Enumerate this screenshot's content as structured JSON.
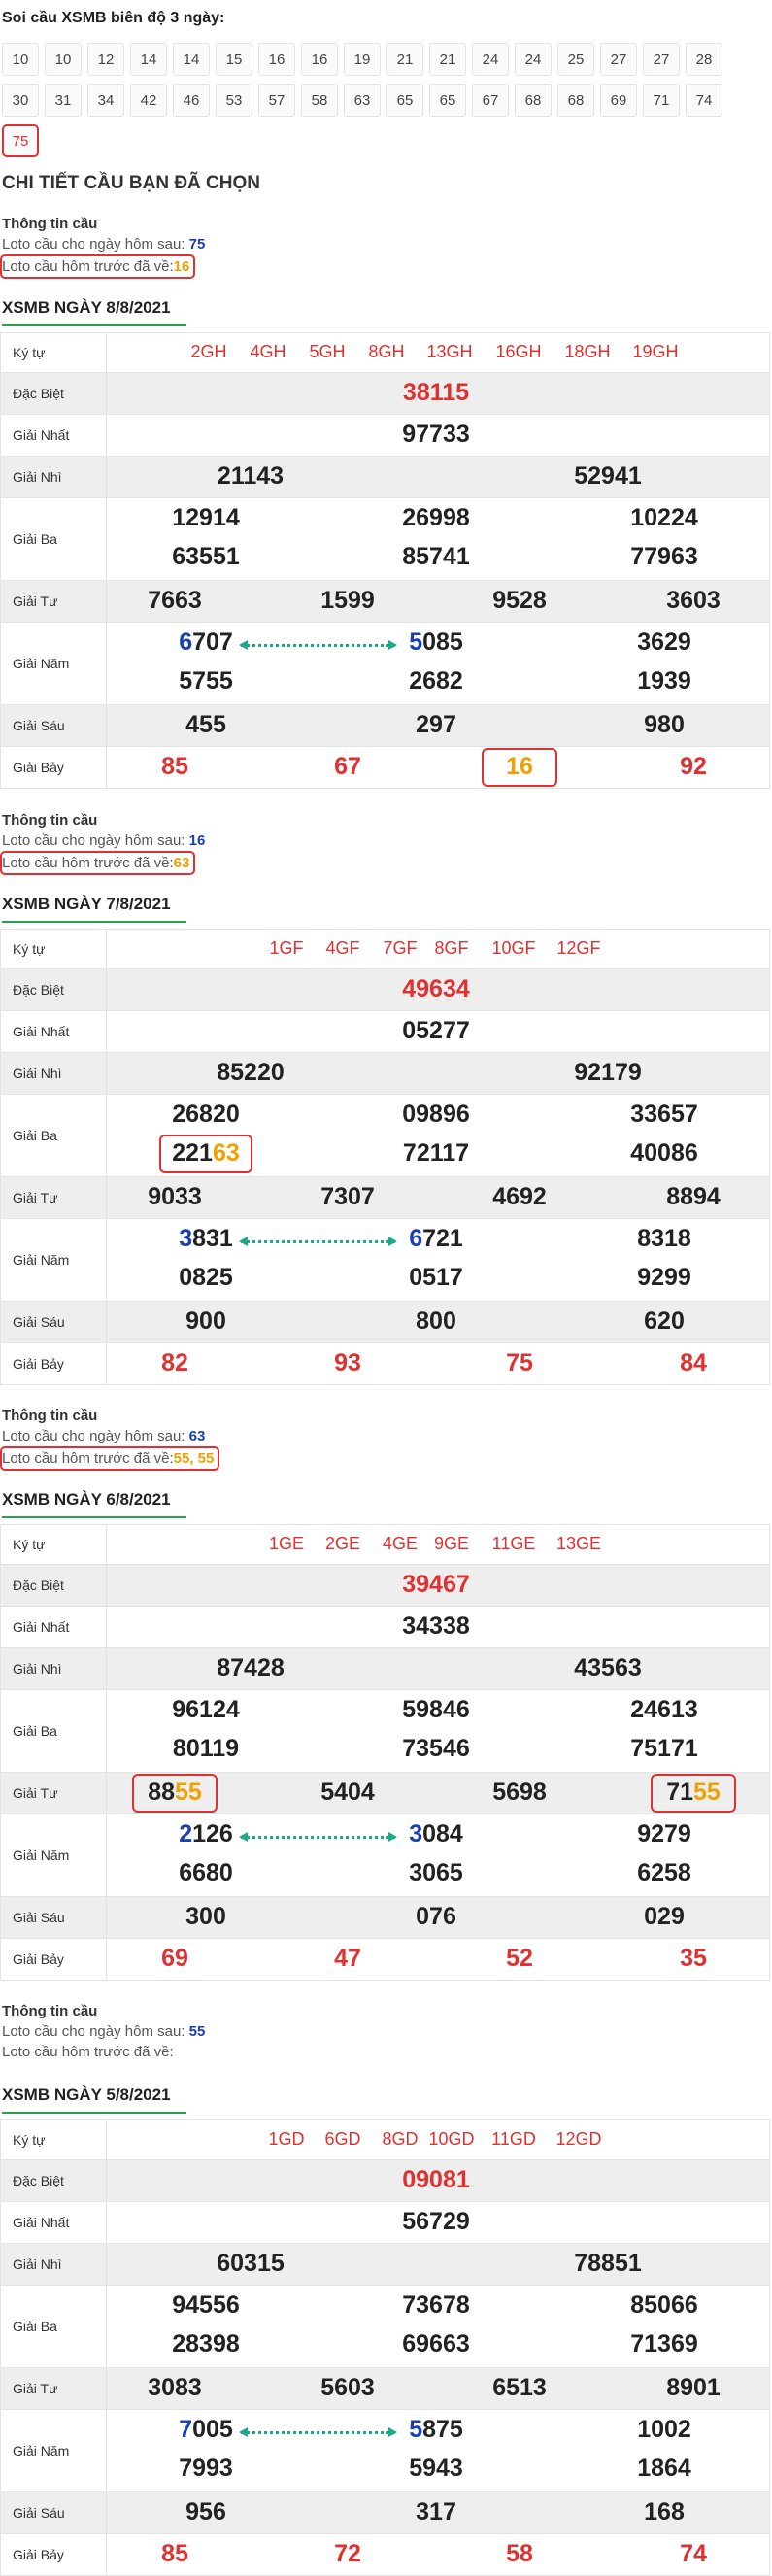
{
  "header": {
    "title": "Soi cầu XSMB biên độ 3 ngày:"
  },
  "lotos": [
    "10",
    "10",
    "12",
    "14",
    "14",
    "15",
    "16",
    "16",
    "19",
    "21",
    "21",
    "24",
    "24",
    "25",
    "27",
    "27",
    "28",
    "30",
    "31",
    "34",
    "42",
    "46",
    "53",
    "57",
    "58",
    "63",
    "65",
    "65",
    "67",
    "68",
    "68",
    "69",
    "71",
    "74",
    "75"
  ],
  "selected_loto": "75",
  "section_title": "CHI TIẾT CẦU BẠN ĐÃ CHỌN",
  "info_labels": {
    "title": "Thông tin cầu",
    "next_day": "Loto cầu cho ngày hôm sau:",
    "prev_day": "Loto cầu hôm trước đã về:"
  },
  "row_labels": {
    "kytu": "Ký tự",
    "db": "Đặc Biệt",
    "g1": "Giải Nhất",
    "g2": "Giải Nhì",
    "g3": "Giải Ba",
    "g4": "Giải Tư",
    "g5": "Giải Năm",
    "g6": "Giải Sáu",
    "g7": "Giải Bảy"
  },
  "days": [
    {
      "info": {
        "next": "75",
        "prev": "16"
      },
      "title": "XSMB NGÀY 8/8/2021",
      "kytu": [
        "2GH",
        "4GH",
        "5GH",
        "8GH",
        "13GH",
        "16GH",
        "18GH",
        "19GH"
      ],
      "db": "38115",
      "g1": "97733",
      "g2": [
        "21143",
        "52941"
      ],
      "g3": [
        [
          "12914",
          "26998",
          "10224"
        ],
        [
          "63551",
          "85741",
          "77963"
        ]
      ],
      "g4": [
        "7663",
        "1599",
        "9528",
        "3603"
      ],
      "g5": [
        [
          "6707",
          "5085",
          "3629"
        ],
        [
          "5755",
          "2682",
          "1939"
        ]
      ],
      "g6": [
        "455",
        "297",
        "980"
      ],
      "g7": [
        "85",
        "67",
        "16",
        "92"
      ]
    },
    {
      "info": {
        "next": "16",
        "prev": "63"
      },
      "title": "XSMB NGÀY 7/8/2021",
      "kytu": [
        "1GF",
        "4GF",
        "7GF",
        "8GF",
        "10GF",
        "12GF"
      ],
      "db": "49634",
      "g1": "05277",
      "g2": [
        "85220",
        "92179"
      ],
      "g3": [
        [
          "26820",
          "09896",
          "33657"
        ],
        [
          "22163",
          "72117",
          "40086"
        ]
      ],
      "g4": [
        "9033",
        "7307",
        "4692",
        "8894"
      ],
      "g5": [
        [
          "3831",
          "6721",
          "8318"
        ],
        [
          "0825",
          "0517",
          "9299"
        ]
      ],
      "g6": [
        "900",
        "800",
        "620"
      ],
      "g7": [
        "82",
        "93",
        "75",
        "84"
      ]
    },
    {
      "info": {
        "next": "63",
        "prev": "55, 55"
      },
      "title": "XSMB NGÀY 6/8/2021",
      "kytu": [
        "1GE",
        "2GE",
        "4GE",
        "9GE",
        "11GE",
        "13GE"
      ],
      "db": "39467",
      "g1": "34338",
      "g2": [
        "87428",
        "43563"
      ],
      "g3": [
        [
          "96124",
          "59846",
          "24613"
        ],
        [
          "80119",
          "73546",
          "75171"
        ]
      ],
      "g4": [
        "8855",
        "5404",
        "5698",
        "7155"
      ],
      "g5": [
        [
          "2126",
          "3084",
          "9279"
        ],
        [
          "6680",
          "3065",
          "6258"
        ]
      ],
      "g6": [
        "300",
        "076",
        "029"
      ],
      "g7": [
        "69",
        "47",
        "52",
        "35"
      ]
    },
    {
      "info": {
        "next": "55",
        "prev": ""
      },
      "title": "XSMB NGÀY 5/8/2021",
      "kytu": [
        "1GD",
        "6GD",
        "8GD",
        "10GD",
        "11GD",
        "12GD"
      ],
      "db": "09081",
      "g1": "56729",
      "g2": [
        "60315",
        "78851"
      ],
      "g3": [
        [
          "94556",
          "73678",
          "85066"
        ],
        [
          "28398",
          "69663",
          "71369"
        ]
      ],
      "g4": [
        "3083",
        "5603",
        "6513",
        "8901"
      ],
      "g5": [
        [
          "7005",
          "5875",
          "1002"
        ],
        [
          "7993",
          "5943",
          "1864"
        ]
      ],
      "g6": [
        "956",
        "317",
        "168"
      ],
      "g7": [
        "85",
        "72",
        "58",
        "74"
      ]
    }
  ],
  "colors": {
    "accent_red": "#e0302f",
    "highlight_orange": "#f0a000",
    "link_blue": "#1a3fb0",
    "underline_green": "#2aa14b",
    "arrow_teal": "#1aaa88"
  }
}
